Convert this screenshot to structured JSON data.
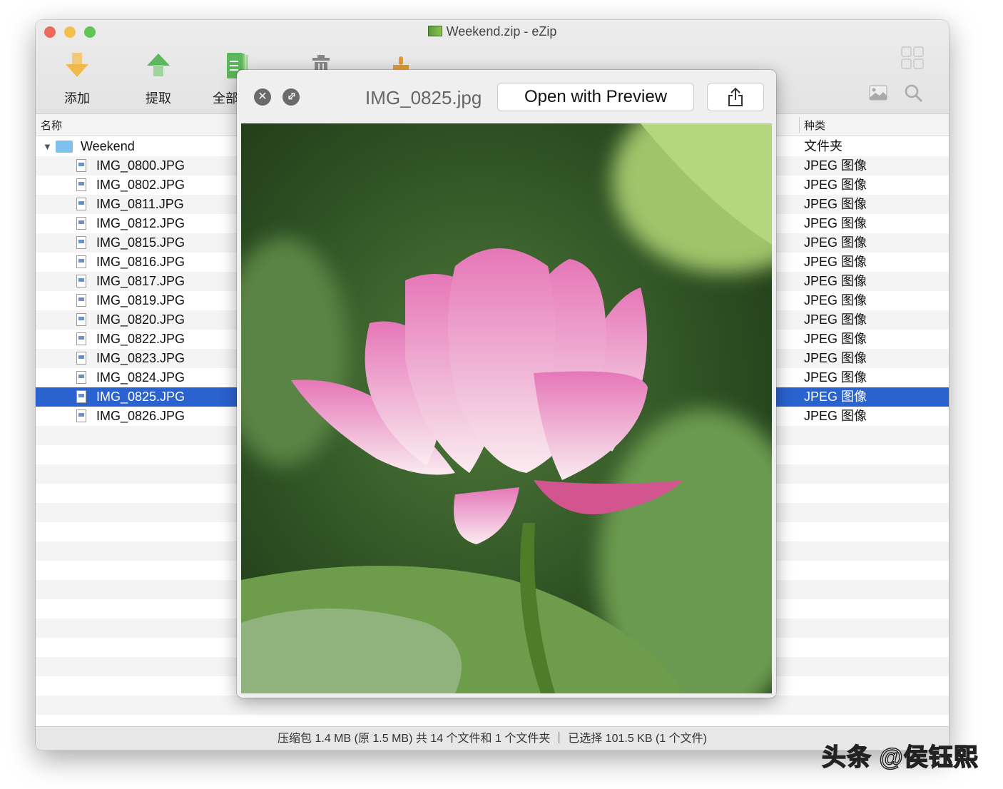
{
  "window": {
    "title": "Weekend.zip - eZip"
  },
  "toolbar": {
    "add_label": "添加",
    "extract_label": "提取",
    "all_label": "全部",
    "icons": [
      "arrow-down-icon",
      "arrow-up-icon",
      "document-icon",
      "trash-icon",
      "brush-icon",
      "grid-view-icon",
      "image-icon",
      "search-icon"
    ]
  },
  "columns": {
    "name": "名称",
    "kind": "种类"
  },
  "files": [
    {
      "name": "Weekend",
      "kind": "文件夹",
      "type": "folder"
    },
    {
      "name": "IMG_0800.JPG",
      "kind": "JPEG 图像"
    },
    {
      "name": "IMG_0802.JPG",
      "kind": "JPEG 图像"
    },
    {
      "name": "IMG_0811.JPG",
      "kind": "JPEG 图像"
    },
    {
      "name": "IMG_0812.JPG",
      "kind": "JPEG 图像"
    },
    {
      "name": "IMG_0815.JPG",
      "kind": "JPEG 图像"
    },
    {
      "name": "IMG_0816.JPG",
      "kind": "JPEG 图像"
    },
    {
      "name": "IMG_0817.JPG",
      "kind": "JPEG 图像"
    },
    {
      "name": "IMG_0819.JPG",
      "kind": "JPEG 图像"
    },
    {
      "name": "IMG_0820.JPG",
      "kind": "JPEG 图像"
    },
    {
      "name": "IMG_0822.JPG",
      "kind": "JPEG 图像"
    },
    {
      "name": "IMG_0823.JPG",
      "kind": "JPEG 图像"
    },
    {
      "name": "IMG_0824.JPG",
      "kind": "JPEG 图像"
    },
    {
      "name": "IMG_0825.JPG",
      "kind": "JPEG 图像",
      "selected": true
    },
    {
      "name": "IMG_0826.JPG",
      "kind": "JPEG 图像"
    }
  ],
  "quicklook": {
    "filename": "IMG_0825.jpg",
    "open_label": "Open with Preview"
  },
  "status": "压缩包 1.4 MB (原 1.5 MB) 共 14 个文件和 1 个文件夹 ｜ 已选择 101.5 KB (1 个文件)",
  "watermark": "头条 @侯钰熙",
  "colors": {
    "selection": "#2a62d0",
    "close": "#ed6a5e",
    "minimize": "#f5bf4f",
    "zoom": "#61c554"
  }
}
